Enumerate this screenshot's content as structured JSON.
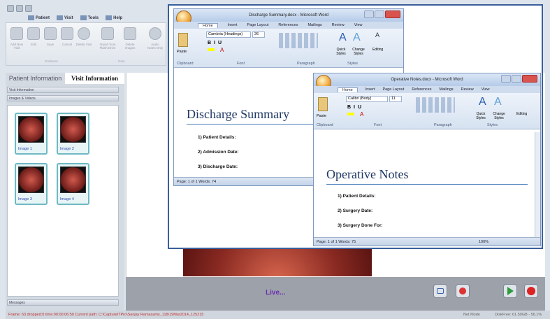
{
  "app": {
    "tabs": [
      "Patient",
      "Visit",
      "Tools",
      "Help"
    ],
    "ribbon_buttons": [
      "Add New Visit",
      "Edit",
      "Save",
      "Cancel",
      "Delete Visit",
      "Import from Flash Drive",
      "Delete Images",
      "Audio Notes Only"
    ],
    "ribbon_groups": [
      "Database",
      "Data"
    ],
    "panel_tabs": [
      "Patient Information",
      "Visit Information"
    ],
    "sections": [
      "Visit Information",
      "Images & Videos"
    ],
    "images": [
      "Image 1",
      "Image 2",
      "Image 3",
      "Image 4"
    ],
    "messages_label": "Messages",
    "live_label": "Live...",
    "status_text": "Frame: 63  dropped:0  time:00:00:06:50   Current path: C:\\CaptureITPro\\Sanjay Ramasamy_118\\19Mar2014_125215",
    "status_right": [
      "Net Mode",
      "DiskFree: 61.50GB - 56.1%"
    ]
  },
  "word1": {
    "title": "Discharge Summary.docx - Microsoft Word",
    "tabs": [
      "Home",
      "Insert",
      "Page Layout",
      "References",
      "Mailings",
      "Review",
      "View"
    ],
    "font": "Cambria (Headings)",
    "size": "26",
    "groups": [
      "Clipboard",
      "Font",
      "Paragraph",
      "Styles",
      "Editing"
    ],
    "paste": "Paste",
    "quick_styles": "Quick Styles",
    "change_styles": "Change Styles",
    "editing": "Editing",
    "heading": "Discharge Summary",
    "items": [
      "1)  Patient Details:",
      "2)  Admission Date:",
      "3)  Discharge Date:"
    ],
    "status": "Page: 1 of 1   Words: 74"
  },
  "word2": {
    "title": "Operative Notes.docx - Microsoft Word",
    "tabs": [
      "Home",
      "Insert",
      "Page Layout",
      "References",
      "Mailings",
      "Review",
      "View"
    ],
    "font": "Calibri (Body)",
    "size": "11",
    "groups": [
      "Clipboard",
      "Font",
      "Paragraph",
      "Styles"
    ],
    "paste": "Paste",
    "quick_styles": "Quick Styles",
    "change_styles": "Change Styles",
    "editing": "Editing",
    "heading": "Operative Notes",
    "items": [
      "1)  Patient Details:",
      "2)  Surgery Date:",
      "3)  Surgery Done For:"
    ],
    "status": "Page: 1 of 1   Words: 75",
    "zoom": "100%"
  }
}
